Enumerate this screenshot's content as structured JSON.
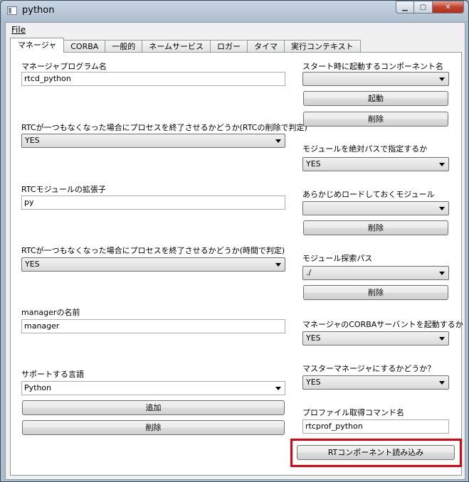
{
  "window": {
    "title": "python"
  },
  "menu": {
    "file": "File"
  },
  "tabs": [
    "マネージャ",
    "CORBA",
    "一般的",
    "ネームサービス",
    "ロガー",
    "タイマ",
    "実行コンテキスト"
  ],
  "left": {
    "program_name_label": "マネージャプログラム名",
    "program_name_value": "rtcd_python",
    "shutdown_rtc_label": "RTCが一つもなくなった場合にプロセスを終了させるかどうか(RTCの削除で判定)",
    "shutdown_rtc_value": "YES",
    "ext_label": "RTCモジュールの拡張子",
    "ext_value": "py",
    "shutdown_time_label": "RTCが一つもなくなった場合にプロセスを終了させるかどうか(時間で判定)",
    "shutdown_time_value": "YES",
    "manager_name_label": "managerの名前",
    "manager_name_value": "manager",
    "lang_label": "サポートする言語",
    "lang_value": "Python",
    "add_button": "追加",
    "delete_button": "削除"
  },
  "right": {
    "startup_label": "スタート時に起動するコンポーネント名",
    "startup_value": "",
    "start_button": "起動",
    "startup_delete_button": "削除",
    "abs_path_label": "モジュールを絶対パスで指定するか",
    "abs_path_value": "YES",
    "preload_label": "あらかじめロードしておくモジュール",
    "preload_value": "",
    "preload_delete_button": "削除",
    "search_path_label": "モジュール探索パス",
    "search_path_value": "./",
    "search_path_delete_button": "削除",
    "corba_servant_label": "マネージャのCORBAサーバントを起動するか",
    "corba_servant_value": "YES",
    "master_label": "マスターマネージャにするかどうか？",
    "master_value": "YES",
    "profile_cmd_label": "プロファイル取得コマンド名",
    "profile_cmd_value": "rtcprof_python",
    "load_button": "RTコンポーネント読み込み"
  },
  "colors": {
    "highlight": "#e3000f",
    "titlebar": "#aebdcd"
  }
}
